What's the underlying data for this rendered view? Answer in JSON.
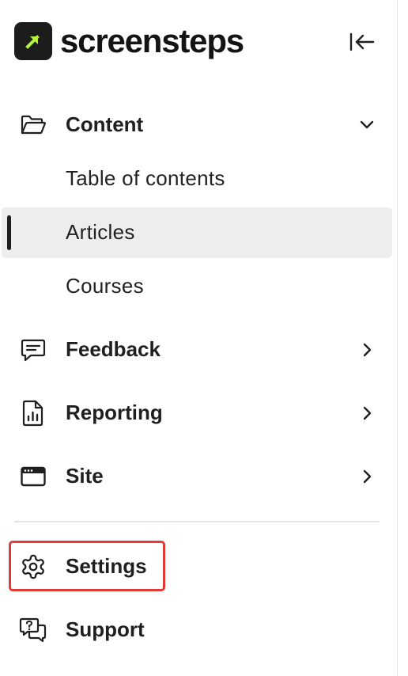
{
  "brand": {
    "name": "screensteps",
    "accent_color": "#b5f23a",
    "mark_color": "#1c1c1c"
  },
  "header": {
    "collapse_icon": "collapse-sidebar-icon"
  },
  "nav": {
    "content": {
      "label": "Content",
      "icon": "folder-open-icon",
      "expanded": true,
      "children": [
        {
          "label": "Table of contents",
          "active": false
        },
        {
          "label": "Articles",
          "active": true
        },
        {
          "label": "Courses",
          "active": false
        }
      ]
    },
    "feedback": {
      "label": "Feedback",
      "icon": "message-square-icon"
    },
    "reporting": {
      "label": "Reporting",
      "icon": "file-chart-icon"
    },
    "site": {
      "label": "Site",
      "icon": "browser-window-icon"
    }
  },
  "footer": {
    "settings": {
      "label": "Settings",
      "icon": "gear-icon",
      "highlighted": true,
      "highlight_color": "#e53935"
    },
    "support": {
      "label": "Support",
      "icon": "help-chat-icon"
    }
  }
}
